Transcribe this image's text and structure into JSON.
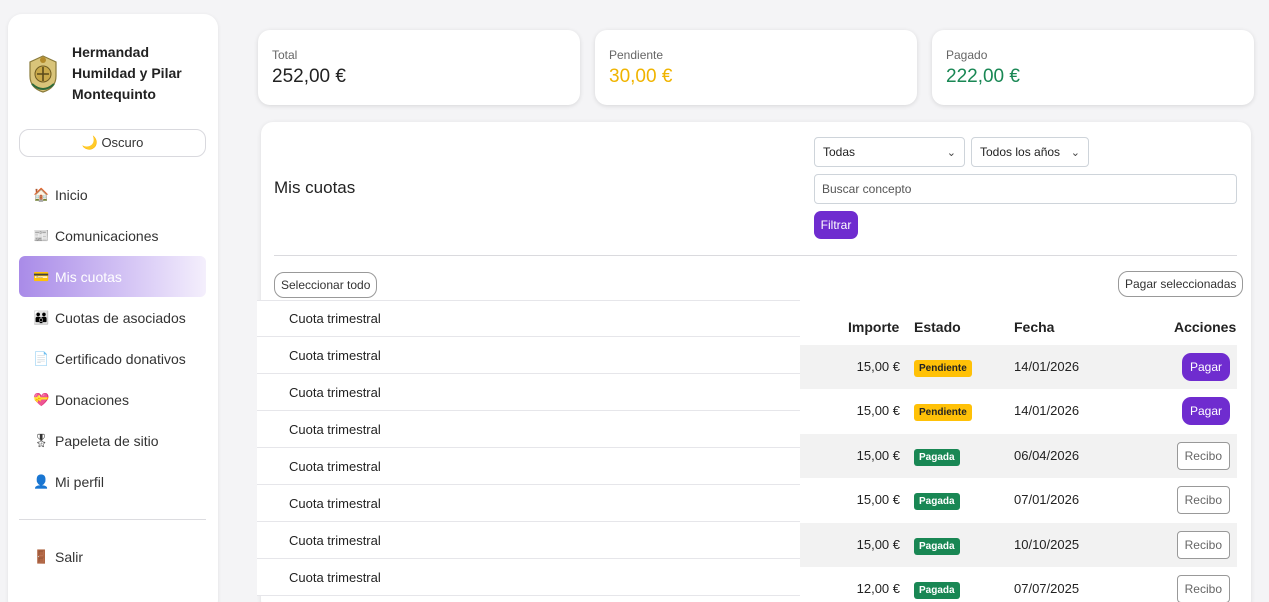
{
  "sidebar": {
    "brand": "Hermandad Humildad y Pilar Montequinto",
    "theme_toggle": "🌙 Oscuro",
    "items": [
      {
        "icon": "🏠",
        "label": "Inicio"
      },
      {
        "icon": "📰",
        "label": "Comunicaciones"
      },
      {
        "icon": "💳",
        "label": "Mis cuotas"
      },
      {
        "icon": "👪",
        "label": "Cuotas de asociados"
      },
      {
        "icon": "📄",
        "label": "Certificado donativos"
      },
      {
        "icon": "💝",
        "label": "Donaciones"
      },
      {
        "icon": "🎖",
        "label": "Papeleta de sitio"
      },
      {
        "icon": "👤",
        "label": "Mi perfil"
      }
    ],
    "logout": {
      "icon": "🚪",
      "label": "Salir"
    }
  },
  "summary": {
    "total": {
      "label": "Total",
      "value": "252,00 €"
    },
    "pending": {
      "label": "Pendiente",
      "value": "30,00 €"
    },
    "paid": {
      "label": "Pagado",
      "value": "222,00 €"
    }
  },
  "main": {
    "title": "Mis cuotas",
    "filter_status": "Todas",
    "filter_year": "Todos los años",
    "search_placeholder": "Buscar concepto",
    "filter_button": "Filtrar",
    "select_all": "Seleccionar todo",
    "pay_selected": "Pagar seleccionadas"
  },
  "table": {
    "headers": {
      "amount": "Importe",
      "status": "Estado",
      "date": "Fecha",
      "actions": "Acciones"
    },
    "concepts": [
      "Cuota trimestral",
      "Cuota trimestral",
      "Cuota trimestral",
      "Cuota trimestral",
      "Cuota trimestral",
      "Cuota trimestral",
      "Cuota trimestral",
      "Cuota trimestral"
    ],
    "rows": [
      {
        "amount": "15,00 €",
        "status": "Pendiente",
        "date": "14/01/2026",
        "action": "Pagar"
      },
      {
        "amount": "15,00 €",
        "status": "Pendiente",
        "date": "14/01/2026",
        "action": "Pagar"
      },
      {
        "amount": "15,00 €",
        "status": "Pagada",
        "date": "06/04/2026",
        "action": "Recibo"
      },
      {
        "amount": "15,00 €",
        "status": "Pagada",
        "date": "07/01/2026",
        "action": "Recibo"
      },
      {
        "amount": "15,00 €",
        "status": "Pagada",
        "date": "10/10/2025",
        "action": "Recibo"
      },
      {
        "amount": "12,00 €",
        "status": "Pagada",
        "date": "07/07/2025",
        "action": "Recibo"
      }
    ]
  },
  "colors": {
    "accent": "#6f2ccf",
    "pending": "#ffc107",
    "paid": "#198754"
  }
}
